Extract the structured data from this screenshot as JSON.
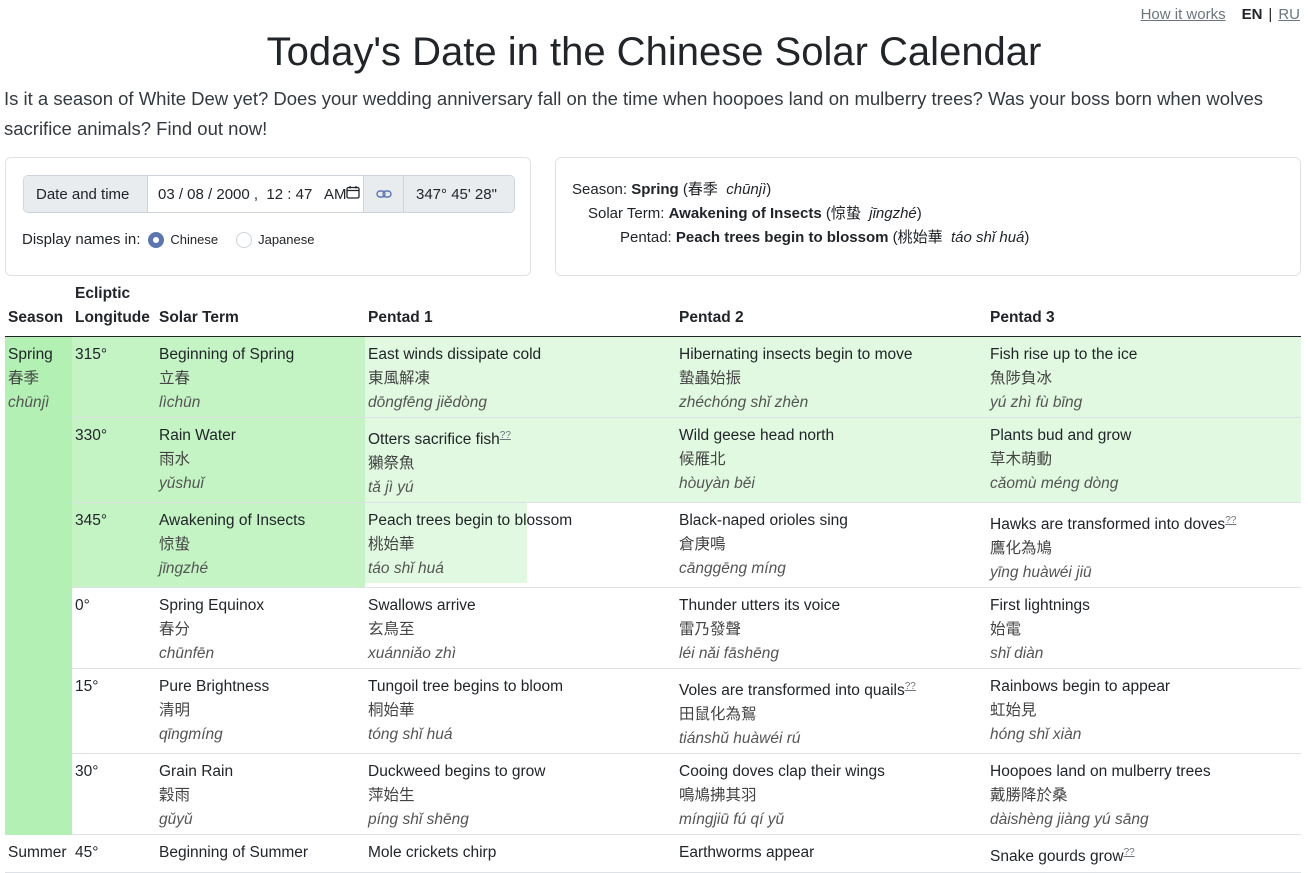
{
  "nav": {
    "how": "How it works",
    "en": "EN",
    "sep": "|",
    "ru": "RU"
  },
  "title": "Today's Date in the Chinese Solar Calendar",
  "intro": "Is it a season of White Dew yet? Does your wedding anniversary fall on the time when hoopoes land on mulberry trees? Was your boss born when wolves sacrifice animals? Find out now!",
  "form": {
    "date_label": "Date and time",
    "date_value": "03 / 08 / 2000 ,  12 : 47   AM",
    "longitude": "347° 45' 28\"",
    "display_label": "Display names in:",
    "options": [
      "Chinese",
      "Japanese"
    ],
    "selected": "Chinese"
  },
  "current": {
    "season_label": "Season:",
    "season": "Spring",
    "season_cn": "春季",
    "season_py": "chūnjì",
    "term_label": "Solar Term:",
    "term": "Awakening of Insects",
    "term_cn": "惊蛰",
    "term_py": "jīngzhé",
    "pentad_label": "Pentad:",
    "pentad": "Peach trees begin to blossom",
    "pentad_cn": "桃始華",
    "pentad_py": "táo shǐ huá"
  },
  "headers": {
    "season": "Season",
    "ecliptic1": "Ecliptic",
    "ecliptic2": "Longitude",
    "term": "Solar Term",
    "p1": "Pentad 1",
    "p2": "Pentad 2",
    "p3": "Pentad 3"
  },
  "seasons": [
    {
      "en": "Spring",
      "cn": "春季",
      "py": "chūnjì"
    },
    {
      "en": "Summer"
    }
  ],
  "rows": [
    {
      "lon": "315°",
      "term": {
        "en": "Beginning of Spring",
        "cn": "立春",
        "py": "lìchūn"
      },
      "p": [
        {
          "en": "East winds dissipate cold",
          "cn": "東風解凍",
          "py": "dōngfēng jiědòng"
        },
        {
          "en": "Hibernating insects begin to move",
          "cn": "蟄蟲始振",
          "py": "zhéchóng shǐ zhèn"
        },
        {
          "en": "Fish rise up to the ice",
          "cn": "魚陟負冰",
          "py": "yú zhì fù bīng"
        }
      ]
    },
    {
      "lon": "330°",
      "term": {
        "en": "Rain Water",
        "cn": "雨水",
        "py": "yǔshuǐ"
      },
      "p": [
        {
          "en": "Otters sacrifice fish",
          "cn": "獺祭魚",
          "py": "tǎ jì yú"
        },
        {
          "en": "Wild geese head north",
          "cn": "候雁北",
          "py": "hòuyàn běi"
        },
        {
          "en": "Plants bud and grow",
          "cn": "草木萌動",
          "py": "cǎomù méng dòng"
        }
      ]
    },
    {
      "lon": "345°",
      "term": {
        "en": "Awakening of Insects",
        "cn": "惊蛰",
        "py": "jīngzhé"
      },
      "p": [
        {
          "en": "Peach trees begin to blossom",
          "cn": "桃始華",
          "py": "táo shǐ huá"
        },
        {
          "en": "Black-naped orioles sing",
          "cn": "倉庚鳴",
          "py": "cānggēng míng"
        },
        {
          "en": "Hawks are transformed into doves",
          "cn": "鷹化為鳩",
          "py": "yīng huàwéi jiū"
        }
      ]
    },
    {
      "lon": "0°",
      "term": {
        "en": "Spring Equinox",
        "cn": "春分",
        "py": "chūnfēn"
      },
      "p": [
        {
          "en": "Swallows arrive",
          "cn": "玄鳥至",
          "py": "xuánniǎo zhì"
        },
        {
          "en": "Thunder utters its voice",
          "cn": "雷乃發聲",
          "py": "léi nǎi fāshēng"
        },
        {
          "en": "First lightnings",
          "cn": "始電",
          "py": "shǐ diàn"
        }
      ]
    },
    {
      "lon": "15°",
      "term": {
        "en": "Pure Brightness",
        "cn": "清明",
        "py": "qīngmíng"
      },
      "p": [
        {
          "en": "Tungoil tree begins to bloom",
          "cn": "桐始華",
          "py": "tóng shǐ huá"
        },
        {
          "en": "Voles are transformed into quails",
          "cn": "田鼠化為鴽",
          "py": "tiánshǔ huàwéi rú"
        },
        {
          "en": "Rainbows begin to appear",
          "cn": "虹始見",
          "py": "hóng shǐ xiàn"
        }
      ]
    },
    {
      "lon": "30°",
      "term": {
        "en": "Grain Rain",
        "cn": "穀雨",
        "py": "gǔyǔ"
      },
      "p": [
        {
          "en": "Duckweed begins to grow",
          "cn": "萍始生",
          "py": "píng shǐ shēng"
        },
        {
          "en": "Cooing doves clap their wings",
          "cn": "鳴鳩拂其羽",
          "py": "míngjiū fú qí yǔ"
        },
        {
          "en": "Hoopoes land on mulberry trees",
          "cn": "戴勝降於桑",
          "py": "dàishèng jiàng yú sāng"
        }
      ]
    },
    {
      "lon": "45°",
      "term": {
        "en": "Beginning of Summer"
      },
      "p": [
        {
          "en": "Mole crickets chirp"
        },
        {
          "en": "Earthworms appear"
        },
        {
          "en": "Snake gourds grow"
        }
      ]
    }
  ],
  "footnote_mark": "??",
  "colors": {
    "season": "#b3f0b3",
    "term_current": "#c4f4c4",
    "row_tint": "#e0f9e0"
  }
}
